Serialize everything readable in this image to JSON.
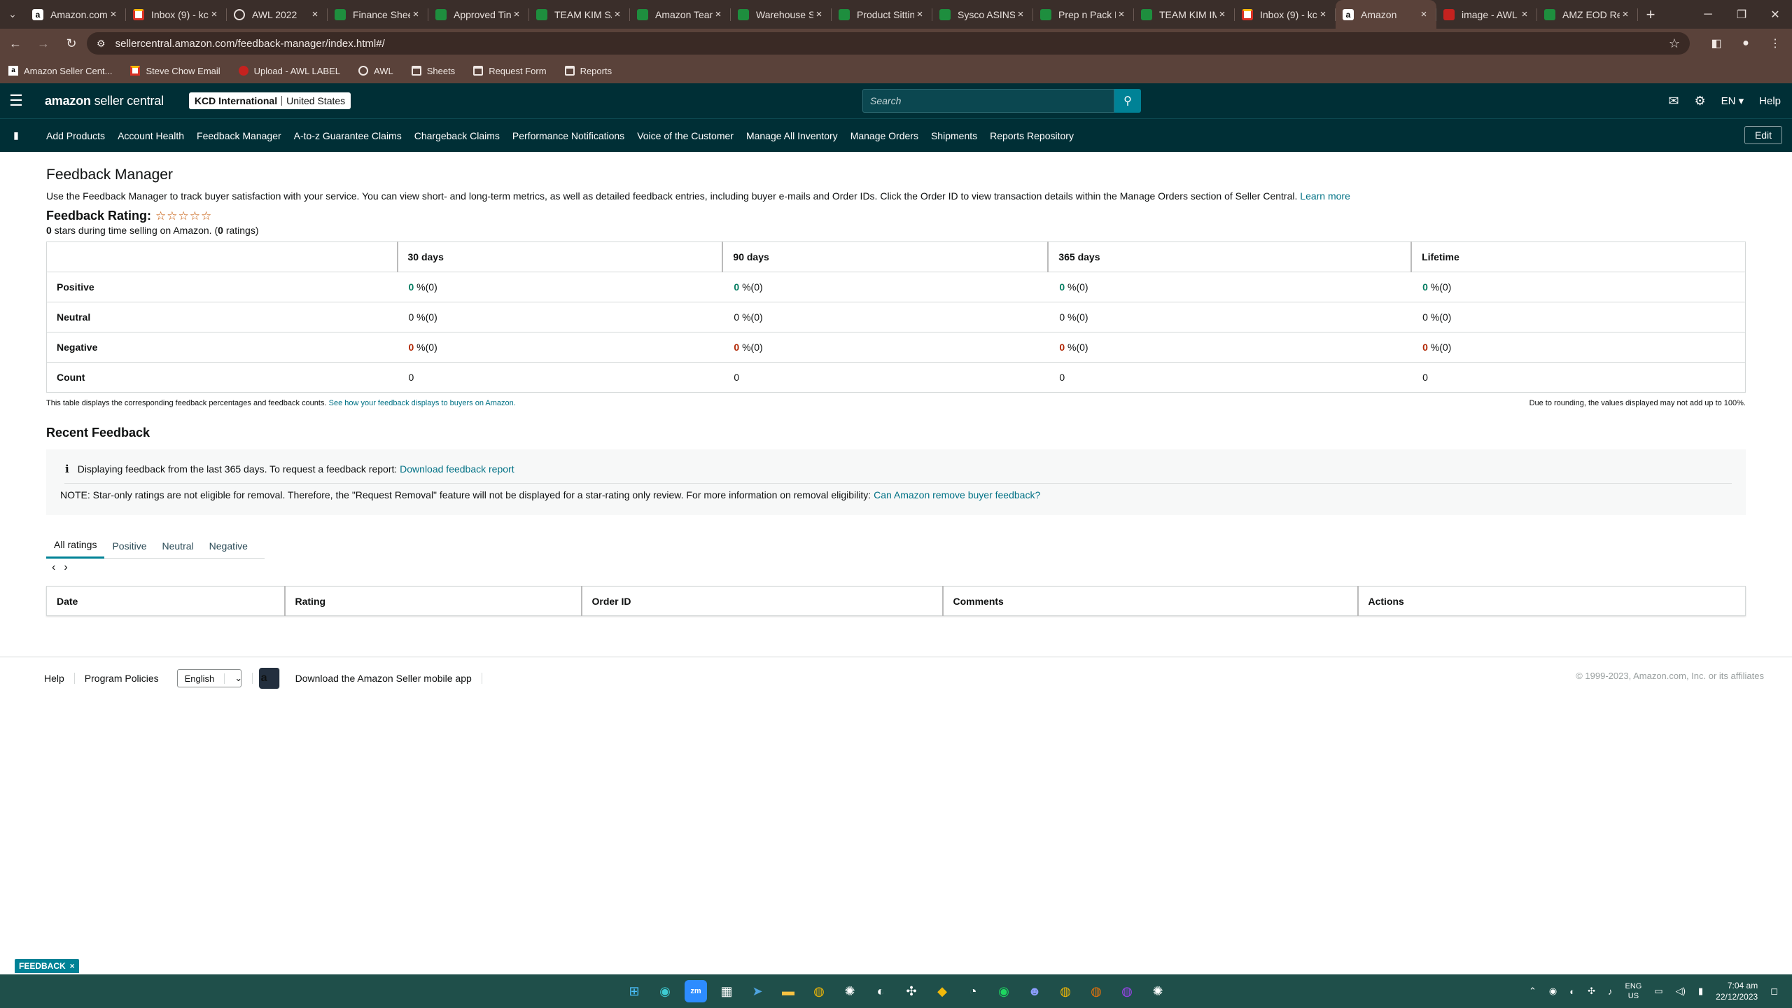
{
  "browser": {
    "tabs": [
      {
        "title": "Amazon.com",
        "icon": "amz",
        "active": false
      },
      {
        "title": "Inbox (9) - kc",
        "icon": "gmail",
        "active": false
      },
      {
        "title": "AWL 2022",
        "icon": "globe",
        "active": false
      },
      {
        "title": "Finance Shee",
        "icon": "sheets",
        "active": false
      },
      {
        "title": "Approved Tin",
        "icon": "sheets",
        "active": false
      },
      {
        "title": "TEAM KIM SA",
        "icon": "sheets",
        "active": false
      },
      {
        "title": "Amazon Tean",
        "icon": "sheets",
        "active": false
      },
      {
        "title": "Warehouse S",
        "icon": "sheets",
        "active": false
      },
      {
        "title": "Product Sittin",
        "icon": "sheets",
        "active": false
      },
      {
        "title": "Sysco ASINS",
        "icon": "sheets",
        "active": false
      },
      {
        "title": "Prep n Pack F",
        "icon": "sheets",
        "active": false
      },
      {
        "title": "TEAM KIM IM",
        "icon": "sheets",
        "active": false
      },
      {
        "title": "Inbox (9) - kc",
        "icon": "gmail",
        "active": false
      },
      {
        "title": "Amazon",
        "icon": "amz",
        "active": true
      },
      {
        "title": "image - AWL",
        "icon": "img",
        "active": false
      },
      {
        "title": "AMZ EOD Re",
        "icon": "sheets",
        "active": false
      }
    ],
    "url": "sellercentral.amazon.com/feedback-manager/index.html#/",
    "bookmarks": [
      {
        "label": "Amazon Seller Cent...",
        "icon": "amz"
      },
      {
        "label": "Steve Chow Email",
        "icon": "gm"
      },
      {
        "label": "Upload - AWL LABEL",
        "icon": "up"
      },
      {
        "label": "AWL",
        "icon": "globe"
      },
      {
        "label": "Sheets",
        "icon": "folder"
      },
      {
        "label": "Request Form",
        "icon": "folder"
      },
      {
        "label": "Reports",
        "icon": "folder"
      }
    ]
  },
  "header": {
    "logo_bold": "amazon",
    "logo_rest": " seller central",
    "account_name": "KCD International",
    "account_region": "United States",
    "search_placeholder": "Search",
    "language": "EN",
    "help": "Help"
  },
  "nav": {
    "links": [
      "Add Products",
      "Account Health",
      "Feedback Manager",
      "A-to-z Guarantee Claims",
      "Chargeback Claims",
      "Performance Notifications",
      "Voice of the Customer",
      "Manage All Inventory",
      "Manage Orders",
      "Shipments",
      "Reports Repository"
    ],
    "edit": "Edit"
  },
  "page": {
    "title": "Feedback Manager",
    "intro": "Use the Feedback Manager to track buyer satisfaction with your service. You can view short- and long-term metrics, as well as detailed feedback entries, including buyer e-mails and Order IDs. Click the Order ID to view transaction details within the Manage Orders section of Seller Central.",
    "learn_more": "Learn more",
    "rating_label": "Feedback Rating:",
    "stars_value": "0",
    "stars_text": " stars during time selling on Amazon. (",
    "ratings_count": "0",
    "ratings_text": " ratings)"
  },
  "feedback_table": {
    "columns": [
      "30 days",
      "90 days",
      "365 days",
      "Lifetime"
    ],
    "rows": [
      {
        "label": "Positive",
        "cells": [
          {
            "num": "0",
            "rest": " %(0)"
          },
          {
            "num": "0",
            "rest": " %(0)"
          },
          {
            "num": "0",
            "rest": " %(0)"
          },
          {
            "num": "0",
            "rest": " %(0)"
          }
        ]
      },
      {
        "label": "Neutral",
        "cells": [
          {
            "num": "0",
            "rest": " %(0)"
          },
          {
            "num": "0",
            "rest": " %(0)"
          },
          {
            "num": "0",
            "rest": " %(0)"
          },
          {
            "num": "0",
            "rest": " %(0)"
          }
        ]
      },
      {
        "label": "Negative",
        "cells": [
          {
            "num": "0",
            "rest": " %(0)"
          },
          {
            "num": "0",
            "rest": " %(0)"
          },
          {
            "num": "0",
            "rest": " %(0)"
          },
          {
            "num": "0",
            "rest": " %(0)"
          }
        ]
      },
      {
        "label": "Count",
        "cells": [
          {
            "num": "",
            "rest": "0"
          },
          {
            "num": "",
            "rest": "0"
          },
          {
            "num": "",
            "rest": "0"
          },
          {
            "num": "",
            "rest": "0"
          }
        ]
      }
    ],
    "note_left": "This table displays the corresponding feedback percentages and feedback counts.",
    "note_link": "See how your feedback displays to buyers on Amazon.",
    "note_right": "Due to rounding, the values displayed may not add up to 100%."
  },
  "recent": {
    "title": "Recent Feedback",
    "info_text": "Displaying feedback from the last 365 days. To request a feedback report:",
    "info_link": "Download feedback report",
    "note_text": "NOTE: Star-only ratings are not eligible for removal. Therefore, the \"Request Removal\" feature will not be displayed for a star-rating only review. For more information on removal eligibility:",
    "note_link": "Can Amazon remove buyer feedback?",
    "tabs": [
      "All ratings",
      "Positive",
      "Neutral",
      "Negative"
    ],
    "columns": [
      "Date",
      "Rating",
      "Order ID",
      "Comments",
      "Actions"
    ]
  },
  "footer": {
    "links": [
      "Help",
      "Program Policies"
    ],
    "language": "English",
    "app_text": "Download the Amazon Seller mobile app",
    "copyright": "© 1999-2023, Amazon.com, Inc. or its affiliates",
    "feedback_pill": "FEEDBACK"
  },
  "taskbar": {
    "lang_top": "ENG",
    "lang_bottom": "US",
    "time": "7:04 am",
    "date": "22/12/2023"
  },
  "colors": {
    "header_bg": "#002f36",
    "positive": "#067d62",
    "negative": "#b12704",
    "link": "#007185"
  }
}
